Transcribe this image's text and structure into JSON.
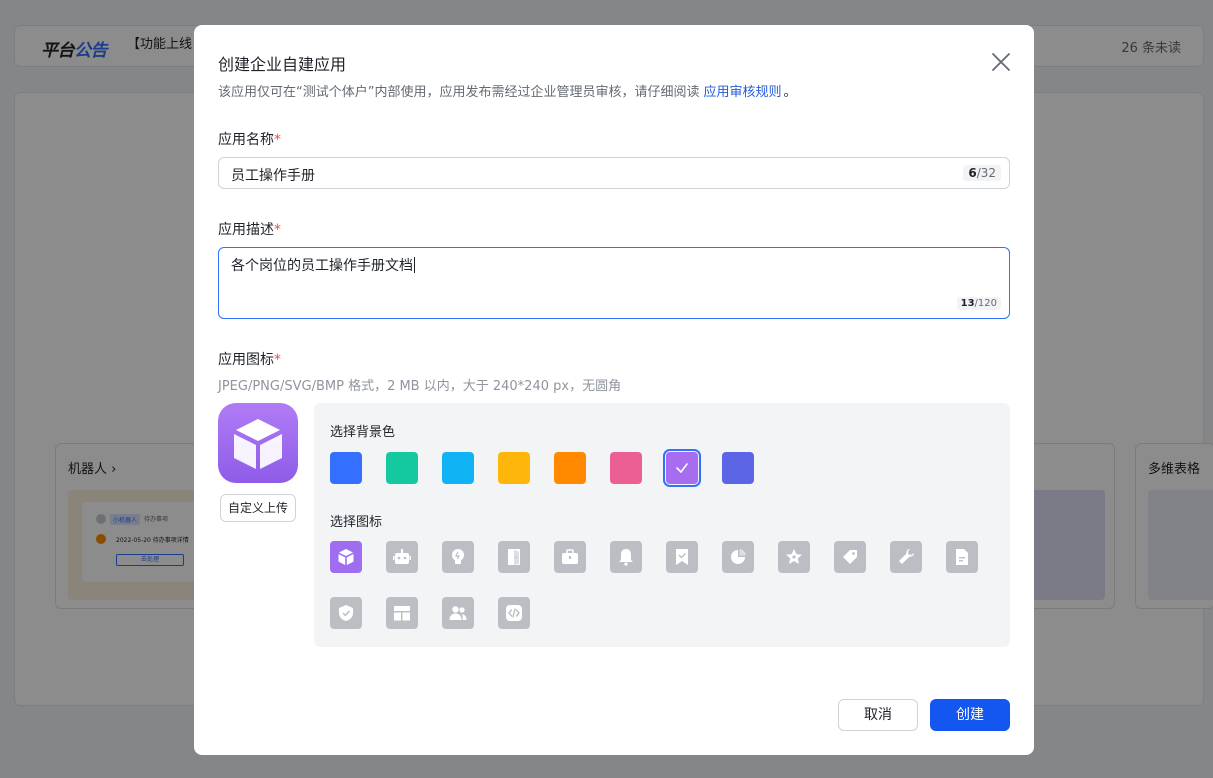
{
  "background": {
    "notice_logo_a": "平台",
    "notice_logo_b": "公告",
    "notice_text": "【功能上线",
    "unread": "26 条未读",
    "card_1_title": "机器人 ›",
    "card_1_bot": "小机器人",
    "card_1_todo": "待办事项",
    "card_1_date": "2022-05-20 待办事项详情",
    "card_1_btn": "去处理",
    "card_3_title": "多维表格"
  },
  "dialog": {
    "title": "创建企业自建应用",
    "subtitle": "该应用仅可在“测试个体户”内部使用，应用发布需经过企业管理员审核，请仔细阅读",
    "subtitle_link": "应用审核规则",
    "subtitle_tail": "。",
    "name_label": "应用名称",
    "name_value": "员工操作手册",
    "name_count": "6",
    "name_max": "/32",
    "desc_label": "应用描述",
    "desc_value": "各个岗位的员工操作手册文档",
    "desc_count": "13",
    "desc_max": "/120",
    "icon_label": "应用图标",
    "required_mark": "*",
    "icon_hint": "JPEG/PNG/SVG/BMP 格式，2 MB 以内，大于 240*240 px，无圆角",
    "upload_label": "自定义上传",
    "bg_color_label": "选择背景色",
    "icon_select_label": "选择图标",
    "cancel_label": "取消",
    "create_label": "创建"
  },
  "colors": {
    "swatches": [
      "#3370ff",
      "#14c9a0",
      "#10b4f5",
      "#ffb60a",
      "#ff8a00",
      "#eb5f95",
      "#a66df0",
      "#5b65e6"
    ],
    "selected_swatch": "#a66df0",
    "primary": "#1456f0",
    "required": "#f54a45"
  },
  "icons": [
    "cube-icon",
    "robot-icon",
    "lightbulb-icon",
    "door-icon",
    "briefcase-icon",
    "bell-icon",
    "bookmark-check-icon",
    "pie-chart-icon",
    "star-icon",
    "tag-icon",
    "wrench-icon",
    "document-icon",
    "shield-check-icon",
    "layout-icon",
    "users-icon",
    "code-icon"
  ],
  "selected_icon": "cube-icon"
}
